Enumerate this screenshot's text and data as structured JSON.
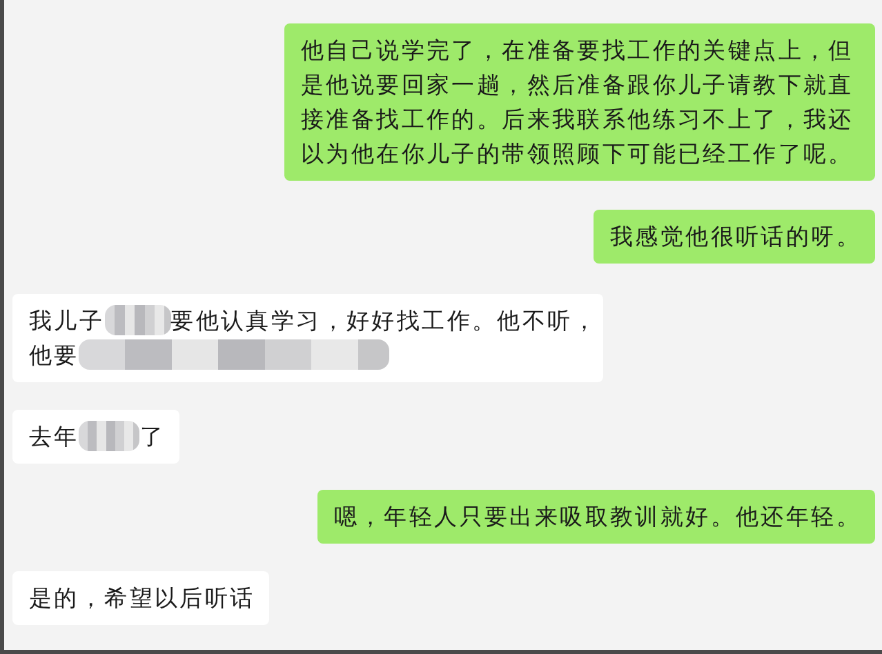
{
  "messages": [
    {
      "kind": "outgoing",
      "lines": [
        [
          {
            "kind": "text",
            "text": "他自己说学完了，在准备要找工作的关键点上，但是他说要回家一趟，然后准备跟你儿子请教下就直接准备找工作的。后来我联系他练习不上了，我还以为他在你儿子的带领照顾下可能已经工作了呢。"
          }
        ]
      ]
    },
    {
      "kind": "outgoing",
      "lines": [
        [
          {
            "kind": "text",
            "text": "我感觉他很听话的呀。"
          }
        ]
      ]
    },
    {
      "kind": "incoming",
      "lines": [
        [
          {
            "kind": "text",
            "text": "我儿子"
          },
          {
            "kind": "redacted"
          },
          {
            "kind": "text",
            "text": "要他认真学习，好好找工作。他不听，"
          }
        ],
        [
          {
            "kind": "text",
            "text": "他要"
          },
          {
            "kind": "redacted"
          }
        ]
      ]
    },
    {
      "kind": "incoming",
      "lines": [
        [
          {
            "kind": "text",
            "text": "去年"
          },
          {
            "kind": "redacted"
          },
          {
            "kind": "text",
            "text": "了"
          }
        ]
      ]
    },
    {
      "kind": "outgoing",
      "lines": [
        [
          {
            "kind": "text",
            "text": "嗯，年轻人只要出来吸取教训就好。他还年轻。"
          }
        ]
      ]
    },
    {
      "kind": "incoming",
      "lines": [
        [
          {
            "kind": "text",
            "text": "是的，希望以后听话"
          }
        ]
      ]
    }
  ]
}
